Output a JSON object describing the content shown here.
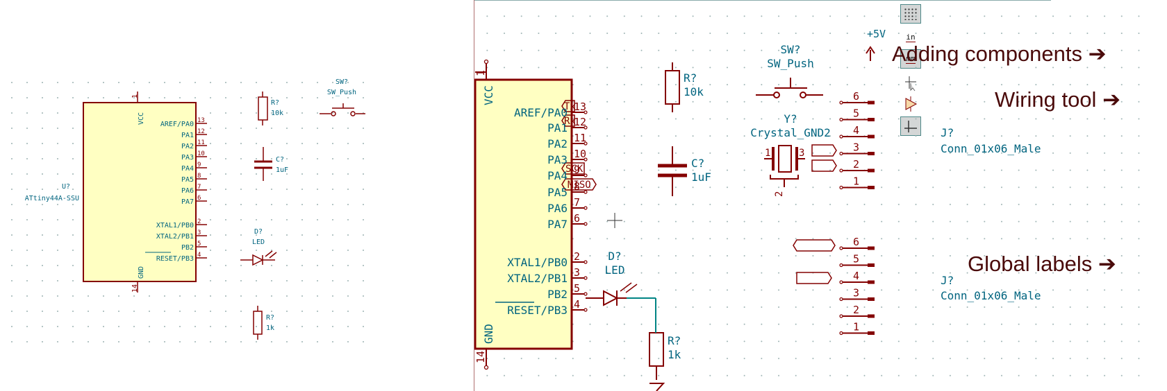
{
  "left_view": {
    "ic": {
      "ref": "U?",
      "value": "ATtiny44A-SSU",
      "vcc": "VCC",
      "gnd": "GND",
      "vcc_pin": "1",
      "gnd_pin": "14"
    },
    "pins": [
      {
        "num": "13",
        "name": "AREF/PA0"
      },
      {
        "num": "12",
        "name": "PA1"
      },
      {
        "num": "11",
        "name": "PA2"
      },
      {
        "num": "10",
        "name": "PA3"
      },
      {
        "num": "9",
        "name": "PA4"
      },
      {
        "num": "8",
        "name": "PA5"
      },
      {
        "num": "7",
        "name": "PA6"
      },
      {
        "num": "6",
        "name": "PA7"
      },
      {
        "num": "2",
        "name": "XTAL1/PB0"
      },
      {
        "num": "3",
        "name": "XTAL2/PB1"
      },
      {
        "num": "5",
        "name": "PB2"
      },
      {
        "num": "4",
        "name": "RESET/PB3"
      }
    ],
    "r1": {
      "ref": "R?",
      "value": "10k"
    },
    "c1": {
      "ref": "C?",
      "value": "1uF"
    },
    "sw": {
      "ref": "SW?",
      "value": "SW_Push"
    },
    "led": {
      "ref": "D?",
      "value": "LED"
    },
    "r2": {
      "ref": "R?",
      "value": "1k"
    }
  },
  "right_view": {
    "ic": {
      "vcc": "VCC",
      "gnd": "GND",
      "vcc_pin": "1",
      "gnd_pin": "14"
    },
    "pins": [
      {
        "num": "13",
        "name": "AREF/PA0"
      },
      {
        "num": "12",
        "name": "PA1"
      },
      {
        "num": "11",
        "name": "PA2"
      },
      {
        "num": "10",
        "name": "PA3"
      },
      {
        "num": "9",
        "name": "PA4"
      },
      {
        "num": "8",
        "name": "PA5"
      },
      {
        "num": "7",
        "name": "PA6"
      },
      {
        "num": "6",
        "name": "PA7"
      },
      {
        "num": "2",
        "name": "XTAL1/PB0"
      },
      {
        "num": "3",
        "name": "XTAL2/PB1"
      },
      {
        "num": "5",
        "name": "PB2"
      },
      {
        "num": "4",
        "name": "RESET/PB3"
      }
    ],
    "labels": {
      "tx": "Tx",
      "rx": "Rx",
      "sck": "SCK",
      "miso": "MISO"
    },
    "r1": {
      "ref": "R?",
      "value": "10k"
    },
    "c1": {
      "ref": "C?",
      "value": "1uF"
    },
    "sw": {
      "ref": "SW?",
      "value": "SW_Push"
    },
    "crystal": {
      "ref": "Y?",
      "value": "Crystal_GND2",
      "pin1": "1",
      "pin2": "2",
      "pin3": "3"
    },
    "power": {
      "label": "+5V"
    },
    "led": {
      "ref": "D?",
      "value": "LED"
    },
    "r2": {
      "ref": "R?",
      "value": "1k"
    },
    "conn1": {
      "ref": "J?",
      "value": "Conn_01x06_Male",
      "pins": [
        "6",
        "5",
        "4",
        "3",
        "2",
        "1"
      ]
    },
    "conn2": {
      "ref": "J?",
      "value": "Conn_01x06_Male",
      "pins": [
        "6",
        "5",
        "4",
        "3",
        "2",
        "1"
      ]
    }
  },
  "annotations": {
    "adding": "Adding components",
    "wiring": "Wiring tool",
    "global": "Global labels",
    "arrow": "➔"
  },
  "left_toolbar": [
    {
      "name": "grid-toggle",
      "label": "",
      "active": true
    },
    {
      "name": "units-inches",
      "label": "in",
      "active": false
    },
    {
      "name": "units-mm",
      "label": "mm",
      "active": true
    },
    {
      "name": "cursor-style",
      "label": "",
      "active": false
    },
    {
      "name": "hidden-pins",
      "label": "",
      "active": false
    },
    {
      "name": "wire-45",
      "label": "",
      "active": true
    }
  ],
  "right_toolbar": [
    {
      "name": "select",
      "active": false
    },
    {
      "name": "highlight-net",
      "active": false
    },
    {
      "name": "add-symbol",
      "active": false
    },
    {
      "name": "add-power",
      "active": false
    },
    {
      "name": "add-wire",
      "active": false
    },
    {
      "name": "add-bus",
      "active": false
    },
    {
      "name": "add-wire-entry",
      "active": false
    },
    {
      "name": "add-bus-entry",
      "active": false
    },
    {
      "name": "no-connect",
      "active": false
    },
    {
      "name": "junction",
      "active": false
    },
    {
      "name": "net-label",
      "active": false
    },
    {
      "name": "global-label",
      "active": true
    },
    {
      "name": "hier-label",
      "active": false
    },
    {
      "name": "hier-sheet",
      "active": false
    },
    {
      "name": "import-sheet-pin",
      "active": false
    },
    {
      "name": "sheet-pin",
      "active": false
    },
    {
      "name": "text",
      "active": false
    }
  ],
  "colors": {
    "wire": "#840000",
    "text": "#00647f",
    "ic_fill": "#ffffc2",
    "wire_net": "#008484",
    "annotation": "#4a0a0a"
  }
}
